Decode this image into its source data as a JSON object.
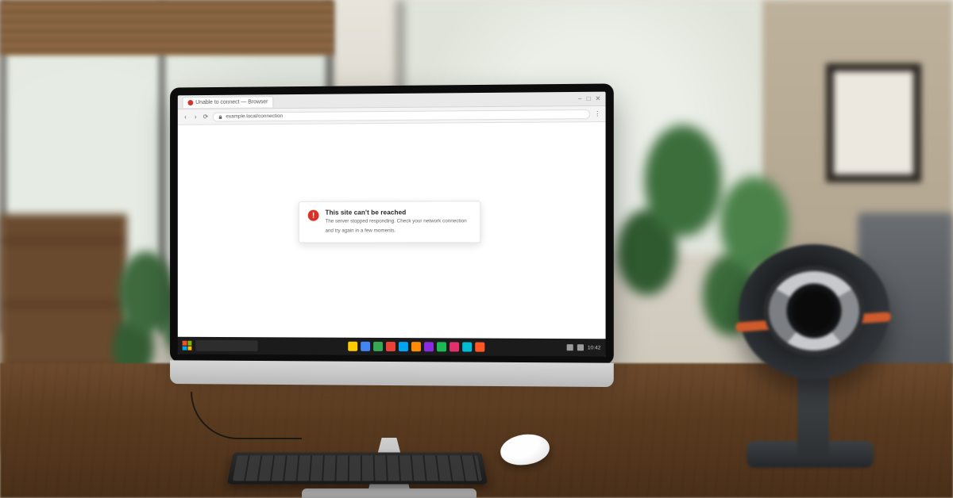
{
  "browser": {
    "tab_title": "Unable to connect — Browser",
    "url_display": "example.local/connection",
    "window_controls": {
      "min": "–",
      "max": "□",
      "close": "✕"
    }
  },
  "error": {
    "title": "This site can't be reached",
    "line1": "The server stopped responding. Check your network connection",
    "line2": "and try again in a few moments."
  },
  "taskbar": {
    "icon_colors": [
      "#ffcc00",
      "#4285f4",
      "#34a853",
      "#ea4335",
      "#00a4ef",
      "#ff8c00",
      "#8a2be2",
      "#1db954",
      "#e1306c",
      "#00bcd4",
      "#ff5722"
    ],
    "time": "10:42"
  }
}
